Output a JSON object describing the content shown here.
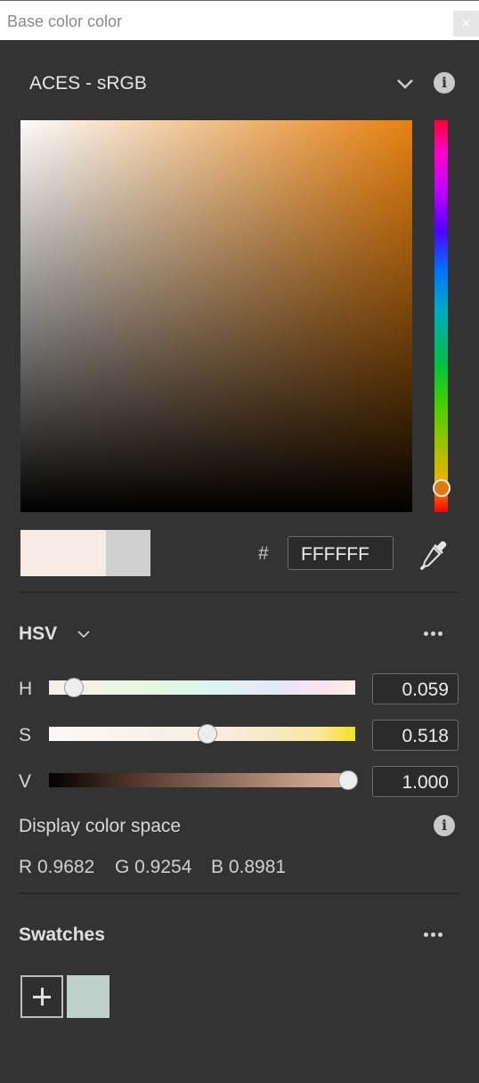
{
  "window": {
    "title": "Base color color",
    "close_glyph": "×"
  },
  "color_space": {
    "label": "ACES - sRGB",
    "dropdown_icon": "chevron-down-icon",
    "info_icon": "info-icon",
    "info_glyph": "i"
  },
  "picker": {
    "hue_value": 0.059,
    "saturation_value": 0.518,
    "value_value": 1.0,
    "new_color": "#f6ece4",
    "old_color": "#cfcfcf"
  },
  "hex": {
    "prefix": "#",
    "value": "FFFFFF",
    "eyedropper_icon": "eyedropper-icon"
  },
  "model": {
    "label": "HSV",
    "dropdown_icon": "chevron-down-icon",
    "more_icon": "more-options-icon"
  },
  "channels": [
    {
      "label": "H",
      "value": "0.059",
      "level": 0.059
    },
    {
      "label": "S",
      "value": "0.518",
      "level": 0.518
    },
    {
      "label": "V",
      "value": "1.000",
      "level": 1.0
    }
  ],
  "display": {
    "label": "Display color space",
    "info_icon": "info-icon",
    "info_glyph": "i",
    "r": "R 0.9682",
    "g": "G 0.9254",
    "b": "B 0.8981"
  },
  "swatches": {
    "label": "Swatches",
    "more_icon": "more-options-icon",
    "add_icon": "plus-icon",
    "items": [
      {
        "color": "#bfcfca"
      }
    ]
  },
  "colors": {
    "background": "#333333",
    "accent_hue_handle": "#e07a10"
  }
}
